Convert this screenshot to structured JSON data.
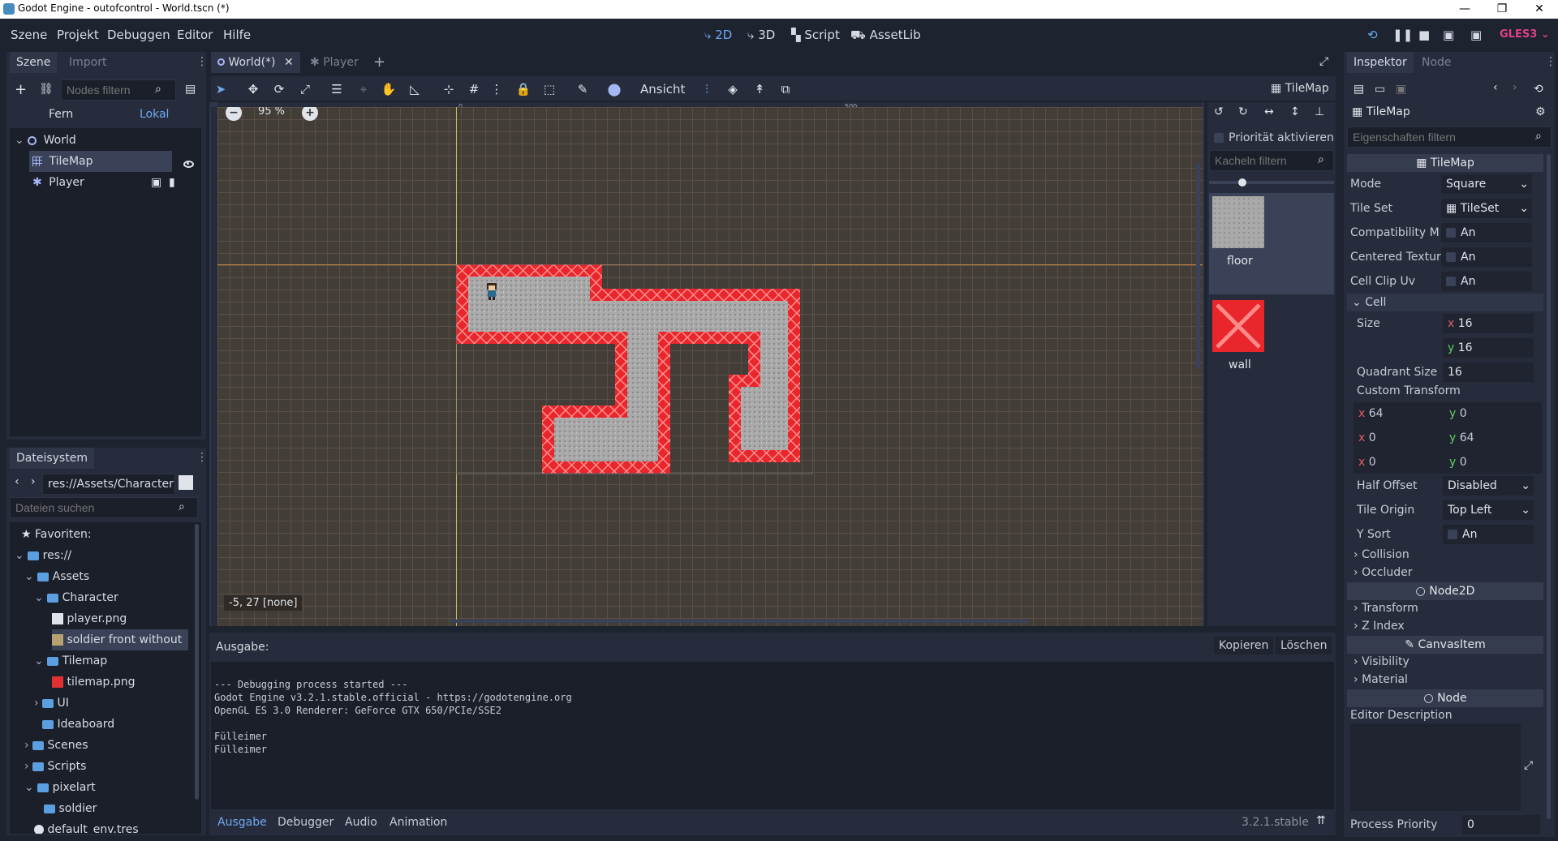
{
  "window": {
    "title": "Godot Engine - outofcontrol - World.tscn (*)"
  },
  "menu": [
    "Szene",
    "Projekt",
    "Debuggen",
    "Editor",
    "Hilfe"
  ],
  "main_screens": {
    "twod": "2D",
    "threed": "3D",
    "script": "Script",
    "assetlib": "AssetLib"
  },
  "renderer": "GLES3",
  "scene_dock": {
    "tabs": [
      "Szene",
      "Import"
    ],
    "filter_placeholder": "Nodes filtern",
    "remote": "Fern",
    "local": "Lokal",
    "tree": [
      {
        "label": "World"
      },
      {
        "label": "TileMap"
      },
      {
        "label": "Player"
      }
    ]
  },
  "filesystem": {
    "tab": "Dateisystem",
    "path": "res://Assets/Character",
    "search_placeholder": "Dateien suchen",
    "items": [
      {
        "label": "Favoriten:"
      },
      {
        "label": "res://"
      },
      {
        "label": "Assets"
      },
      {
        "label": "Character"
      },
      {
        "label": "player.png"
      },
      {
        "label": "soldier front without"
      },
      {
        "label": "Tilemap"
      },
      {
        "label": "tilemap.png"
      },
      {
        "label": "UI"
      },
      {
        "label": "Ideaboard"
      },
      {
        "label": "Scenes"
      },
      {
        "label": "Scripts"
      },
      {
        "label": "pixelart"
      },
      {
        "label": "soldier"
      },
      {
        "label": "default_env.tres"
      }
    ]
  },
  "editor_tabs": [
    "World(*)",
    "Player"
  ],
  "toolbar": {
    "view_label": "Ansicht",
    "tilemap_label": "TileMap"
  },
  "viewport": {
    "zoom": "95 %",
    "ruler_0": "0",
    "ruler_500": "500",
    "status": "-5, 27 [none]"
  },
  "tile_palette": {
    "priority_label": "Priorität aktivieren",
    "filter_placeholder": "Kacheln filtern",
    "tiles": [
      {
        "label": "floor"
      },
      {
        "label": "wall"
      }
    ]
  },
  "output": {
    "title": "Ausgabe:",
    "copy": "Kopieren",
    "clear": "Löschen",
    "lines": "--- Debugging process started ---\nGodot Engine v3.2.1.stable.official - https://godotengine.org\nOpenGL ES 3.0 Renderer: GeForce GTX 650/PCIe/SSE2\n\nFülleimer\nFülleimer",
    "tabs": [
      "Ausgabe",
      "Debugger",
      "Audio",
      "Animation"
    ],
    "version": "3.2.1.stable"
  },
  "inspector": {
    "tabs": [
      "Inspektor",
      "Node"
    ],
    "object": "TileMap",
    "filter_placeholder": "Eigenschaften filtern",
    "class_header": "TileMap",
    "mode_label": "Mode",
    "mode_value": "Square",
    "tileset_label": "Tile Set",
    "tileset_value": "TileSet",
    "compat_label": "Compatibility M",
    "compat_value": "An",
    "centered_label": "Centered Textur",
    "centered_value": "An",
    "clipuv_label": "Cell Clip Uv",
    "clipuv_value": "An",
    "cell_section": "Cell",
    "size_label": "Size",
    "size_x": "16",
    "size_y": "16",
    "quadrant_label": "Quadrant Size",
    "quadrant_value": "16",
    "custom_transform": "Custom Transform",
    "ct": [
      [
        "64",
        "0"
      ],
      [
        "0",
        "64"
      ],
      [
        "0",
        "0"
      ]
    ],
    "half_offset_label": "Half Offset",
    "half_offset_value": "Disabled",
    "tile_origin_label": "Tile Origin",
    "tile_origin_value": "Top Left",
    "ysort_label": "Y Sort",
    "ysort_value": "An",
    "collision": "Collision",
    "occluder": "Occluder",
    "node2d_header": "Node2D",
    "transform": "Transform",
    "zindex": "Z Index",
    "canvasitem_header": "CanvasItem",
    "visibility": "Visibility",
    "material": "Material",
    "node_header": "Node",
    "editor_desc": "Editor Description",
    "process_priority_label": "Process Priority",
    "process_priority_value": "0"
  }
}
